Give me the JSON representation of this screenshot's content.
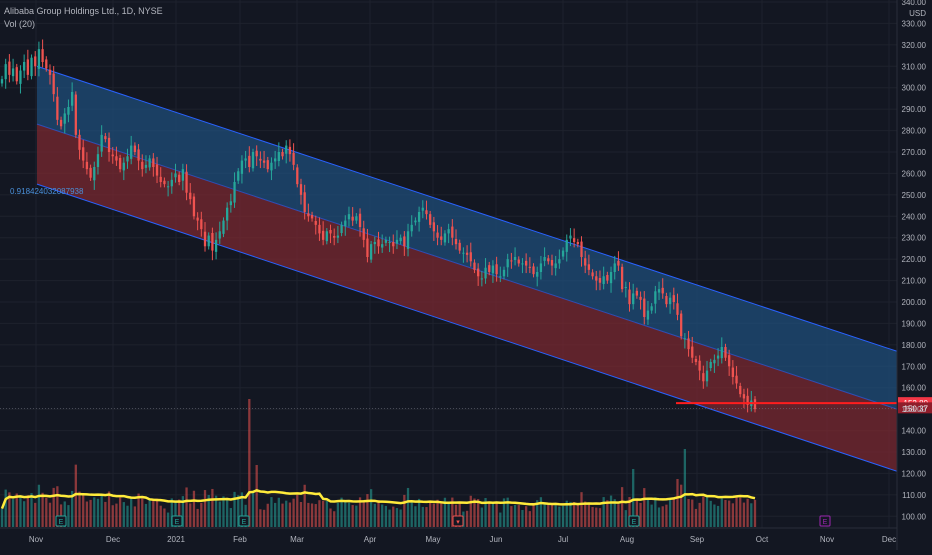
{
  "header": {
    "symbol_line": "Alibaba Group Holdings Ltd., 1D, NYSE",
    "volume_line": "Vol (20)",
    "currency": "USD"
  },
  "colors": {
    "background": "#131722",
    "up": "#26a69a",
    "down": "#ef5350",
    "upper_band": "#1f4e7a",
    "lower_band": "#7a2830",
    "band_line": "#2962ff",
    "volume_ma": "#ffeb3b",
    "price_line": "#ff1e1e",
    "event_earnings": "#26a69a",
    "event_dividend": "#ef5350",
    "event_future": "#9c27b0"
  },
  "chart_data": {
    "type": "candlestick",
    "title": "Alibaba Group Holdings Ltd., 1D, NYSE",
    "y_axis": {
      "min": 95,
      "max": 340,
      "ticks": [
        100,
        110,
        120,
        130,
        140,
        150,
        160,
        170,
        180,
        190,
        200,
        210,
        220,
        230,
        240,
        250,
        260,
        270,
        280,
        290,
        300,
        310,
        320,
        330,
        340
      ],
      "currency": "USD"
    },
    "x_axis": {
      "labels": [
        "Nov",
        "Dec",
        "2021",
        "Feb",
        "Mar",
        "Apr",
        "May",
        "Jun",
        "Jul",
        "Aug",
        "Sep",
        "Oct",
        "Nov",
        "Dec"
      ],
      "last_data_label": "Sep"
    },
    "regression_channel": {
      "label": "0.918424032087938",
      "upper": {
        "start": 310,
        "end": 177
      },
      "middle": {
        "start": 283,
        "end": 150
      },
      "lower": {
        "start": 255,
        "end": 121
      }
    },
    "price_markers": [
      {
        "label": "152.80",
        "value": 152.8
      },
      {
        "label": "150.37",
        "value": 150.37
      }
    ],
    "closes": [
      304,
      311,
      306,
      309,
      303,
      308,
      312,
      306,
      314,
      310,
      318,
      312,
      309,
      306,
      297,
      285,
      282,
      288,
      291,
      298,
      278,
      271,
      266,
      262,
      258,
      263,
      269,
      278,
      276,
      270,
      268,
      266,
      262,
      265,
      268,
      273,
      270,
      266,
      262,
      264,
      267,
      263,
      259,
      256,
      255,
      254,
      257,
      260,
      256,
      262,
      251,
      248,
      240,
      238,
      234,
      226,
      231,
      224,
      229,
      233,
      238,
      244,
      247,
      256,
      261,
      266,
      267,
      263,
      270,
      268,
      266,
      265,
      262,
      265,
      267,
      270,
      268,
      273,
      269,
      264,
      255,
      250,
      242,
      240,
      239,
      236,
      232,
      229,
      233,
      232,
      230,
      231,
      236,
      238,
      241,
      238,
      240,
      235,
      229,
      221,
      227,
      228,
      226,
      227,
      229,
      228,
      226,
      229,
      230,
      226,
      233,
      236,
      238,
      242,
      244,
      241,
      236,
      233,
      230,
      229,
      232,
      234,
      230,
      227,
      224,
      223,
      222,
      219,
      215,
      212,
      211,
      216,
      214,
      217,
      213,
      212,
      215,
      220,
      219,
      221,
      218,
      218,
      217,
      216,
      213,
      214,
      218,
      221,
      219,
      217,
      218,
      220,
      224,
      229,
      231,
      228,
      227,
      221,
      217,
      215,
      212,
      210,
      209,
      212,
      210,
      214,
      218,
      217,
      206,
      207,
      199,
      204,
      203,
      201,
      193,
      196,
      198,
      205,
      206,
      204,
      199,
      202,
      200,
      194,
      184,
      183,
      178,
      174,
      172,
      168,
      163,
      168,
      172,
      173,
      175,
      179,
      174,
      170,
      165,
      162,
      157,
      155,
      152,
      154,
      150
    ]
  }
}
